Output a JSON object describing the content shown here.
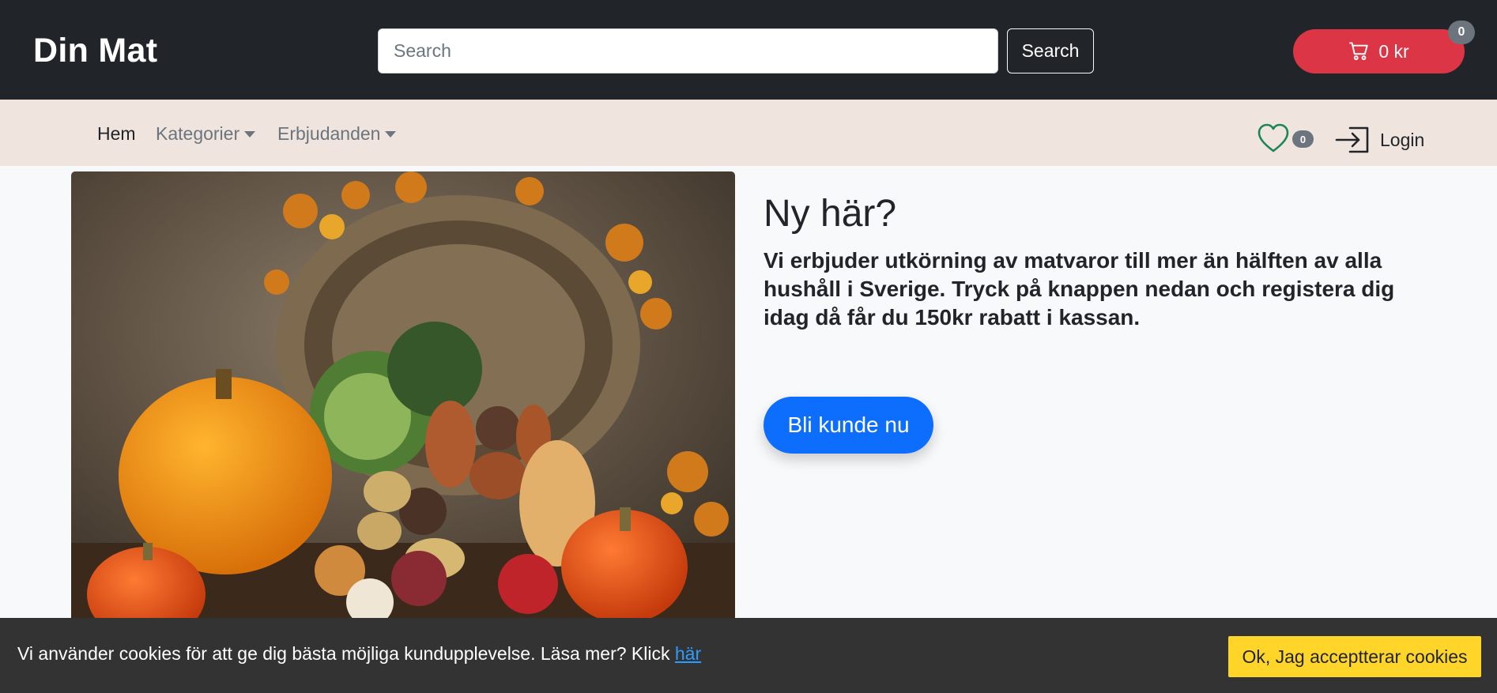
{
  "header": {
    "brand": "Din Mat",
    "search": {
      "placeholder": "Search",
      "button_label": "Search"
    },
    "cart": {
      "total": "0 kr",
      "count": "0",
      "icon": "cart-icon"
    }
  },
  "nav": {
    "items": [
      {
        "label": "Hem",
        "active": true
      },
      {
        "label": "Kategorier",
        "dropdown": true
      },
      {
        "label": "Erbjudanden",
        "dropdown": true
      }
    ],
    "favorites": {
      "icon": "heart-icon",
      "count": "0"
    },
    "login": {
      "label": "Login",
      "icon": "login-icon"
    }
  },
  "hero": {
    "image": "vegetable-basket-photo",
    "title": "Ny här?",
    "text": "Vi erbjuder utkörning av matvaror till mer än hälften av alla hushåll i Sverige. Tryck på knappen nedan och registera dig idag då får du 150kr rabatt i kassan.",
    "cta_label": "Bli kunde nu"
  },
  "cookie": {
    "text": "Vi använder cookies för att ge dig bästa möjliga kundupplevelse. Läsa mer? Klick ",
    "link_label": "här",
    "accept_label": "Ok, Jag acceptterar cookies"
  },
  "colors": {
    "header_bg": "#212529",
    "nav_bg": "#efe4de",
    "cart": "#dc3545",
    "cta": "#0d6efd",
    "cookie_bg": "#333333",
    "cookie_btn": "#ffd529",
    "heart": "#198754"
  }
}
